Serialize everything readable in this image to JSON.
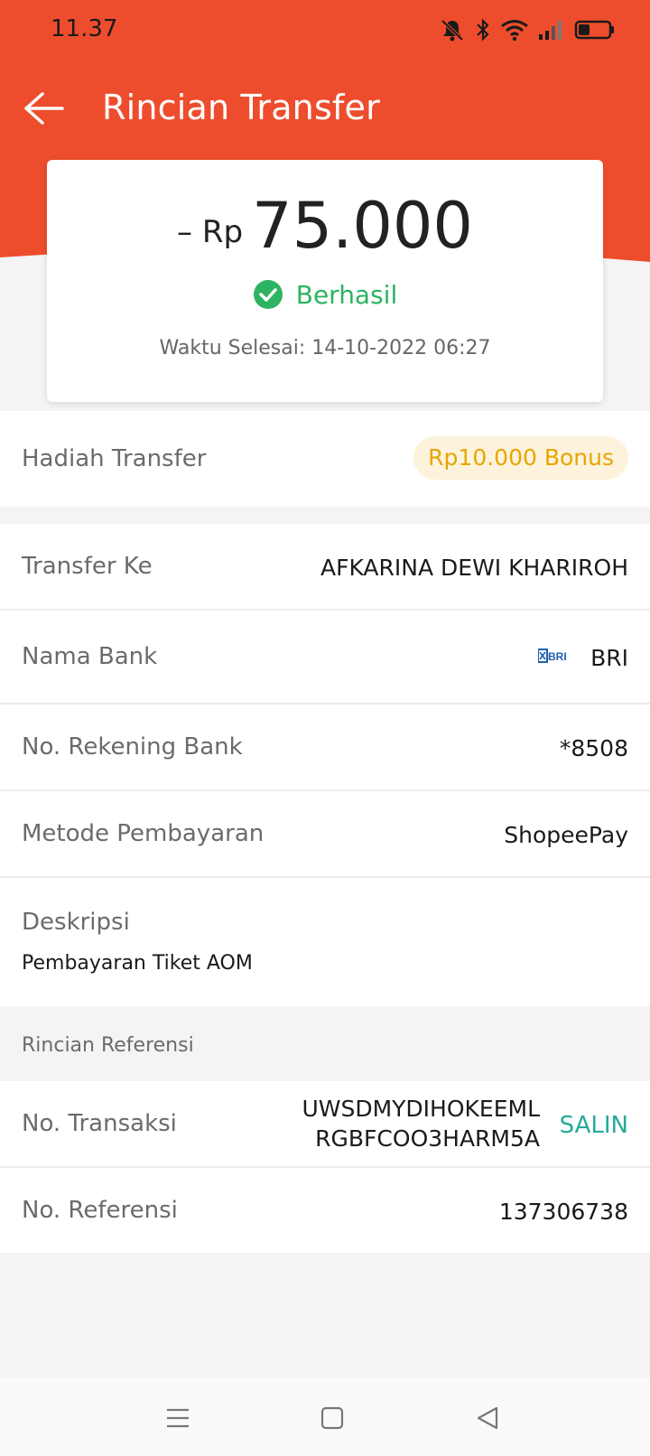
{
  "status_bar": {
    "time": "11.37",
    "icons": [
      "mute-icon",
      "bluetooth-icon",
      "wifi-icon",
      "signal-icon",
      "battery-icon"
    ]
  },
  "header": {
    "title": "Rincian Transfer",
    "back_icon": "arrow-left-icon",
    "color": "#ee4d2d"
  },
  "summary": {
    "amount_prefix": "– Rp",
    "amount": "75.000",
    "status": "Berhasil",
    "status_color": "#2db362",
    "completed_time": "Waktu Selesai: 14-10-2022 06:27"
  },
  "reward": {
    "label": "Hadiah Transfer",
    "badge": "Rp10.000 Bonus"
  },
  "details": {
    "transfer_to_label": "Transfer Ke",
    "transfer_to_value": "AFKARINA DEWI KHARIROH",
    "bank_name_label": "Nama Bank",
    "bank_name_value": "BRI",
    "bank_logo_text": "BRI",
    "account_label": "No. Rekening Bank",
    "account_value": "*8508",
    "payment_method_label": "Metode Pembayaran",
    "payment_method_value": "ShopeePay",
    "description_label": "Deskripsi",
    "description_value": "Pembayaran Tiket AOM"
  },
  "reference": {
    "section_title": "Rincian Referensi",
    "transaction_label": "No. Transaksi",
    "transaction_line1": "UWSDMYDIHOKEEML",
    "transaction_line2": "RGBFCOO3HARM5A",
    "copy_label": "SALIN",
    "reference_label": "No. Referensi",
    "reference_value": "137306738"
  },
  "nav": {
    "buttons": [
      "menu-icon",
      "home-icon",
      "back-triangle-icon"
    ]
  }
}
